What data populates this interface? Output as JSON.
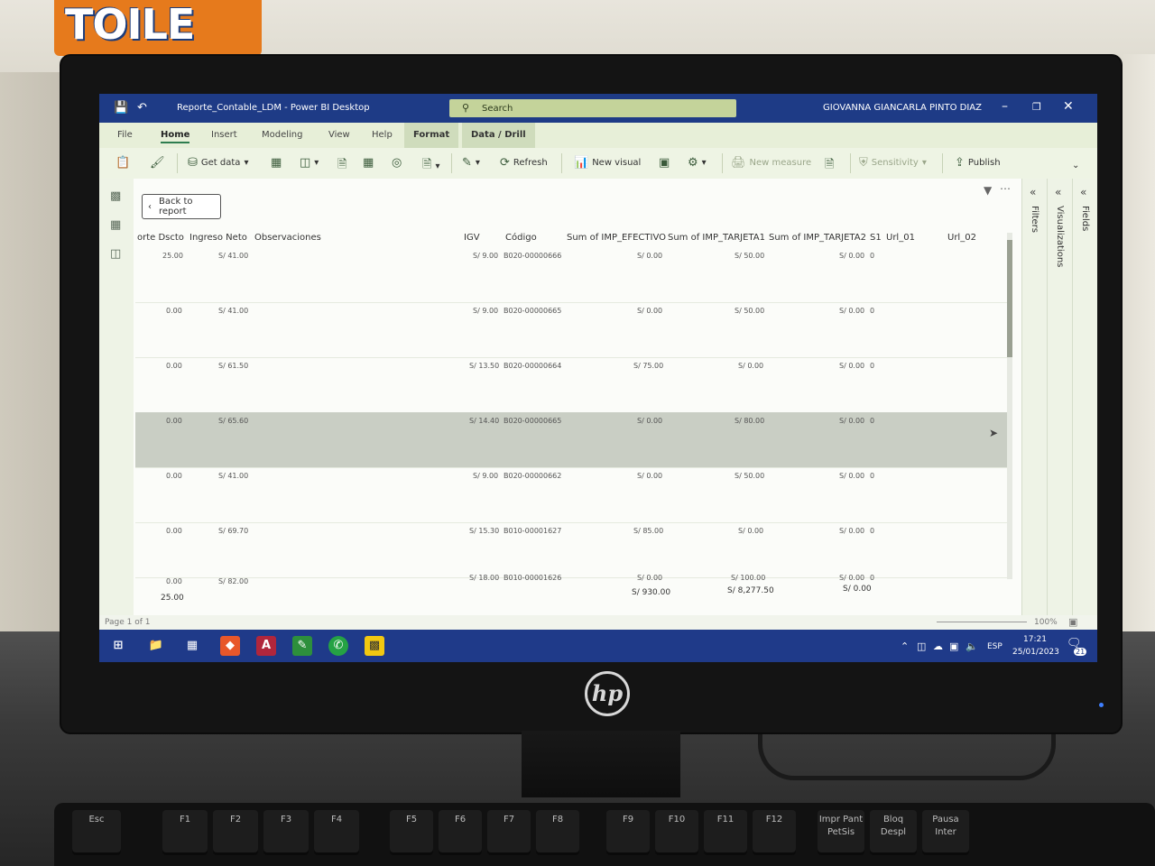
{
  "environment": {
    "poster_text": "TOILE",
    "brand": "hp"
  },
  "window": {
    "title": "Reporte_Contable_LDM - Power BI Desktop",
    "search_placeholder": "Search",
    "user": "GIOVANNA GIANCARLA PINTO DIAZ"
  },
  "menu": {
    "items": [
      "File",
      "Home",
      "Insert",
      "Modeling",
      "View",
      "Help"
    ],
    "active": "Home",
    "context_tabs": [
      "Format",
      "Data / Drill"
    ]
  },
  "ribbon": {
    "get_data": "Get data",
    "refresh": "Refresh",
    "new_visual": "New visual",
    "new_measure": "New measure",
    "sensitivity": "Sensitivity",
    "publish": "Publish"
  },
  "canvas": {
    "back_to_report": "Back to report"
  },
  "table": {
    "columns": {
      "dscto": "orte Dscto",
      "ingreso": "Ingreso Neto",
      "obs": "Observaciones",
      "igv": "IGV",
      "codigo": "Código",
      "efectivo": "Sum of IMP_EFECTIVO",
      "tarjeta1": "Sum of IMP_TARJETA1",
      "tarjeta2": "Sum of IMP_TARJETA2",
      "s1": "S1",
      "url01": "Url_01",
      "url02": "Url_02"
    },
    "rows": [
      {
        "dscto": "25.00",
        "ingreso": "S/ 41.00",
        "igv": "S/ 9.00",
        "codigo": "B020-00000666",
        "efectivo": "S/ 0.00",
        "tarjeta1": "S/ 50.00",
        "tarjeta2": "S/ 0.00",
        "s1": "0"
      },
      {
        "dscto": "0.00",
        "ingreso": "S/ 41.00",
        "igv": "S/ 9.00",
        "codigo": "B020-00000665",
        "efectivo": "S/ 0.00",
        "tarjeta1": "S/ 50.00",
        "tarjeta2": "S/ 0.00",
        "s1": "0"
      },
      {
        "dscto": "0.00",
        "ingreso": "S/ 61.50",
        "igv": "S/ 13.50",
        "codigo": "B020-00000664",
        "efectivo": "S/ 75.00",
        "tarjeta1": "S/ 0.00",
        "tarjeta2": "S/ 0.00",
        "s1": "0"
      },
      {
        "dscto": "0.00",
        "ingreso": "S/ 65.60",
        "igv": "S/ 14.40",
        "codigo": "B020-00000665",
        "efectivo": "S/ 0.00",
        "tarjeta1": "S/ 80.00",
        "tarjeta2": "S/ 0.00",
        "s1": "0"
      },
      {
        "dscto": "0.00",
        "ingreso": "S/ 41.00",
        "igv": "S/ 9.00",
        "codigo": "B020-00000662",
        "efectivo": "S/ 0.00",
        "tarjeta1": "S/ 50.00",
        "tarjeta2": "S/ 0.00",
        "s1": "0"
      },
      {
        "dscto": "0.00",
        "ingreso": "S/ 69.70",
        "igv": "S/ 15.30",
        "codigo": "B010-00001627",
        "efectivo": "S/ 85.00",
        "tarjeta1": "S/ 0.00",
        "tarjeta2": "S/ 0.00",
        "s1": "0"
      },
      {
        "dscto": "0.00",
        "ingreso": "S/ 82.00",
        "igv": "S/ 18.00",
        "codigo": "B010-00001626",
        "efectivo": "S/ 0.00",
        "tarjeta1": "S/ 100.00",
        "tarjeta2": "S/ 0.00",
        "s1": "0"
      }
    ],
    "totals": {
      "dscto": "25.00",
      "efectivo": "S/ 930.00",
      "tarjeta1": "S/ 8,277.50",
      "tarjeta2": "S/ 0.00"
    }
  },
  "panes": {
    "filters": "Filters",
    "visualizations": "Visualizations",
    "fields": "Fields"
  },
  "status": {
    "page": "Page 1 of 1",
    "zoom": "100%"
  },
  "taskbar": {
    "lang": "ESP",
    "time": "17:21",
    "date": "25/01/2023",
    "notif_count": "21"
  },
  "keyboard": {
    "keys": [
      "Esc",
      "F1",
      "F2",
      "F3",
      "F4",
      "F5",
      "F6",
      "F7",
      "F8",
      "F9",
      "F10",
      "F11",
      "F12",
      "Impr Pant PetSis",
      "Bloq Despl",
      "Pausa Inter"
    ]
  }
}
